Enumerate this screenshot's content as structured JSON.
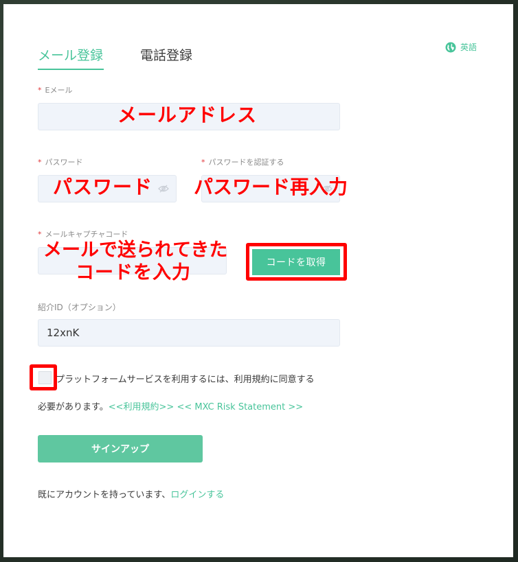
{
  "tabs": {
    "email": "メール登録",
    "phone": "電話登録"
  },
  "language": {
    "label": "英語",
    "icon": "globe-icon"
  },
  "fields": {
    "email": {
      "required_mark": "*",
      "label": "Eメール",
      "value": ""
    },
    "password": {
      "required_mark": "*",
      "label": "パスワード",
      "value": ""
    },
    "password_confirm": {
      "required_mark": "*",
      "label": "パスワードを認証する",
      "value": ""
    },
    "captcha": {
      "required_mark": "*",
      "label": "メールキャプチャコード",
      "value": ""
    },
    "referral": {
      "label": "紹介ID（オプション）",
      "value": "12xnK"
    }
  },
  "buttons": {
    "get_code": "コードを取得",
    "signup": "サインアップ"
  },
  "terms": {
    "line1": "プラットフォームサービスを利用するには、利用規約に同意する",
    "line2_prefix": "必要があります。",
    "link_terms_a": "<<利用",
    "link_terms_b": "規約>>",
    "link_risk": "<< MXC Risk Statement >>"
  },
  "login": {
    "prefix": "既にアカウントを持っています、",
    "link": "ログインする"
  },
  "annotations": {
    "email": "メールアドレス",
    "password": "パスワード",
    "password_confirm": "パスワード再入力",
    "captcha_line1": "メールで送られてきた",
    "captcha_line2": "コードを入力"
  },
  "colors": {
    "accent": "#48c49a",
    "annotation": "#ff0000",
    "required": "#e0373a"
  }
}
